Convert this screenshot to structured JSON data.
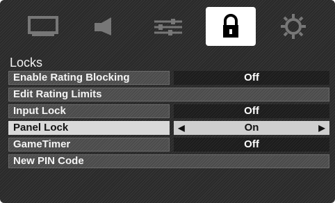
{
  "tabs": [
    {
      "icon": "picture-icon",
      "active": false
    },
    {
      "icon": "speaker-icon",
      "active": false
    },
    {
      "icon": "adjustments-icon",
      "active": false
    },
    {
      "icon": "lock-icon",
      "active": true
    },
    {
      "icon": "gear-icon",
      "active": false
    }
  ],
  "panel": {
    "title": "Locks",
    "rows": [
      {
        "label": "Enable Rating Blocking",
        "value": "Off"
      },
      {
        "label": "Edit Rating Limits",
        "value": ""
      },
      {
        "label": "Input Lock",
        "value": "Off"
      },
      {
        "label": "Panel Lock",
        "value": "On"
      },
      {
        "label": "GameTimer",
        "value": "Off"
      },
      {
        "label": "New PIN Code",
        "value": ""
      }
    ]
  },
  "colors": {
    "background": "#2a2a2a",
    "active_tab": "#ffffff",
    "selected_row": "#d9d9d9"
  }
}
